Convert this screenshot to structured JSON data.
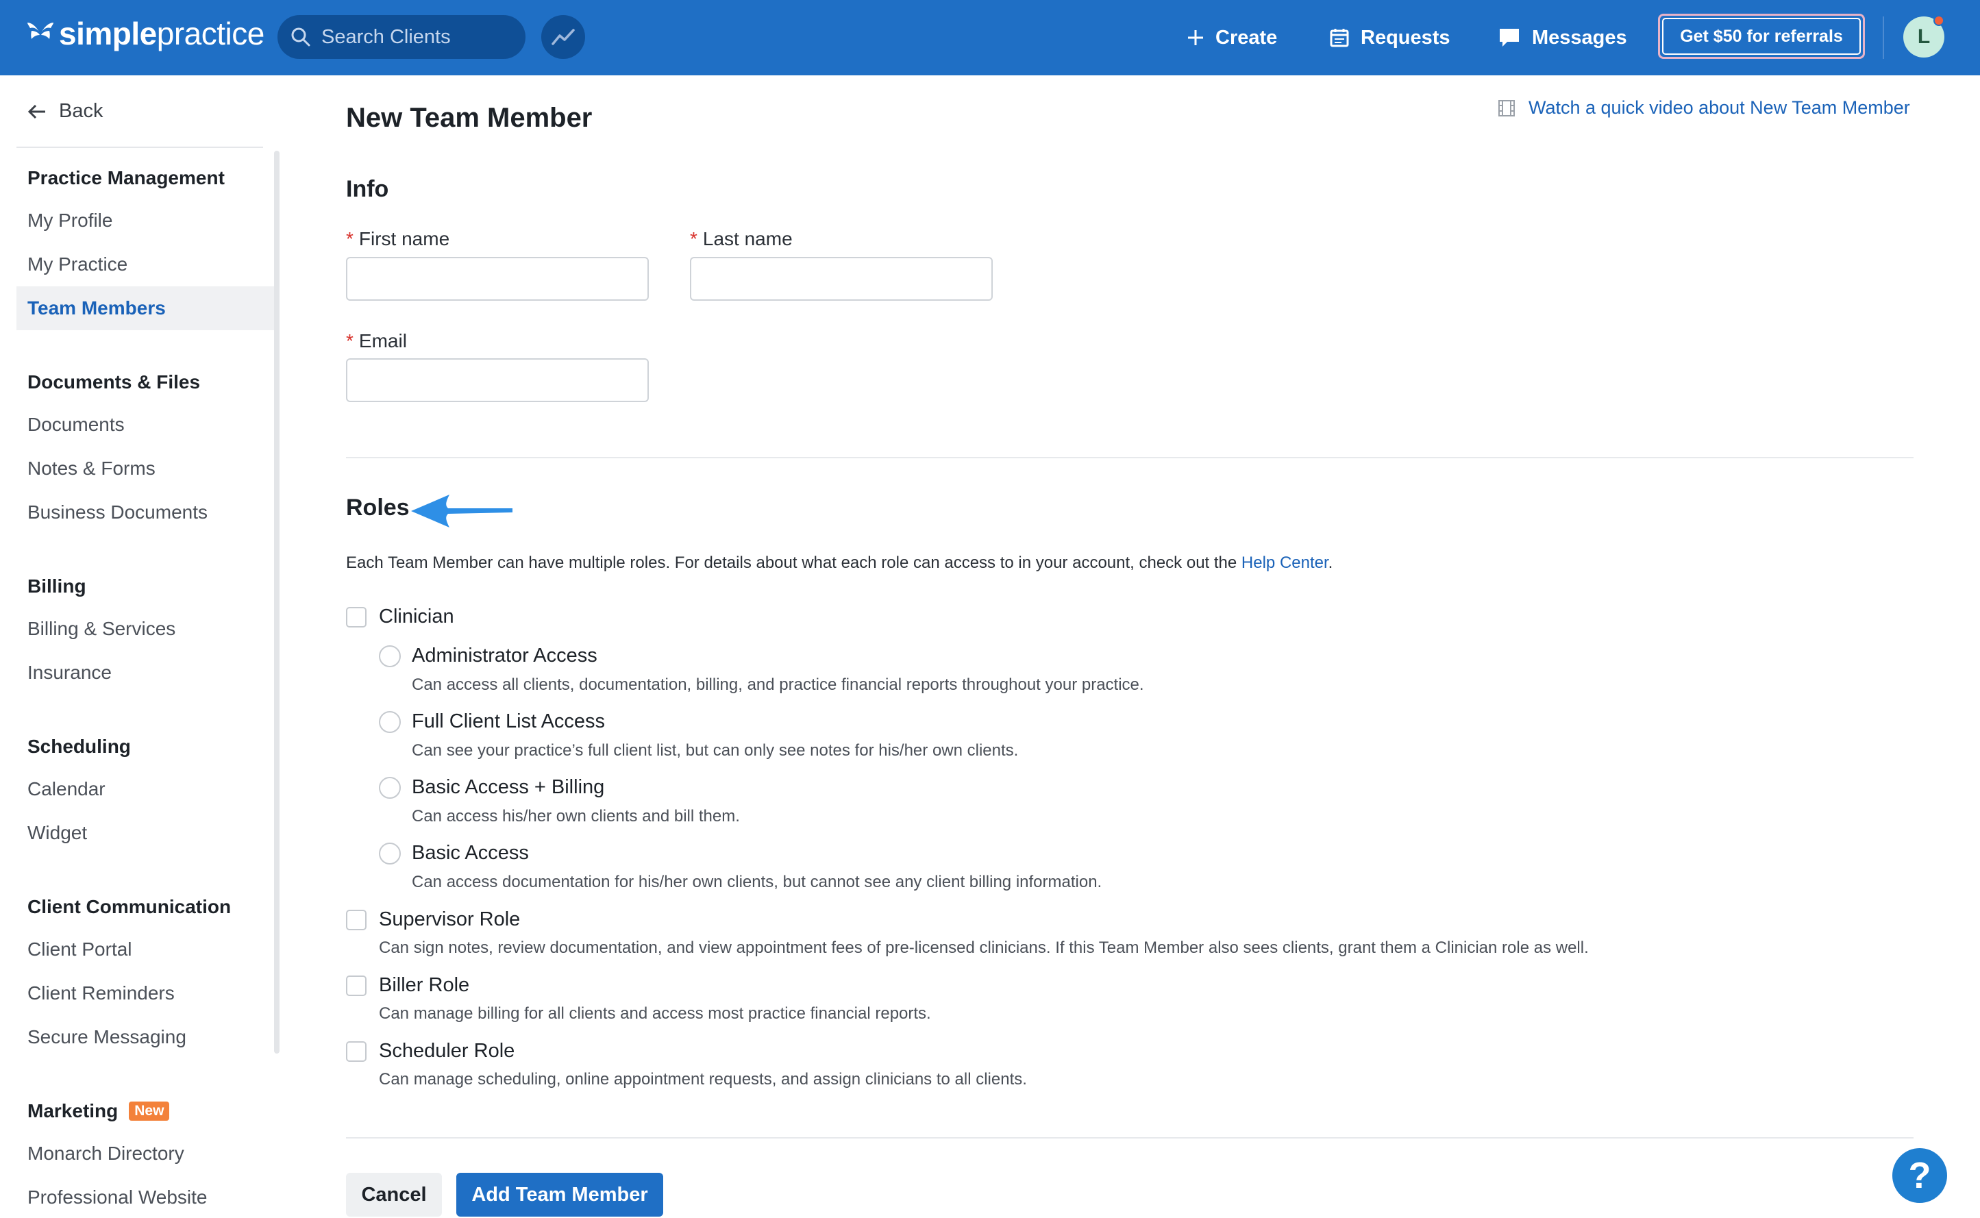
{
  "topbar": {
    "logo_bold": "simple",
    "logo_light": "practice",
    "search_placeholder": "Search Clients",
    "create_label": "Create",
    "requests_label": "Requests",
    "messages_label": "Messages",
    "referral_label": "Get $50 for referrals",
    "avatar_initial": "L"
  },
  "sidebar": {
    "back_label": "Back",
    "sections": [
      {
        "title": "Practice Management",
        "items": [
          "My Profile",
          "My Practice",
          "Team Members"
        ]
      },
      {
        "title": "Documents & Files",
        "items": [
          "Documents",
          "Notes & Forms",
          "Business Documents"
        ]
      },
      {
        "title": "Billing",
        "items": [
          "Billing & Services",
          "Insurance"
        ]
      },
      {
        "title": "Scheduling",
        "items": [
          "Calendar",
          "Widget"
        ]
      },
      {
        "title": "Client Communication",
        "items": [
          "Client Portal",
          "Client Reminders",
          "Secure Messaging"
        ]
      },
      {
        "title": "Marketing",
        "badge": "New",
        "items": [
          "Monarch Directory",
          "Professional Website"
        ]
      }
    ],
    "active_item": "Team Members"
  },
  "main": {
    "title": "New Team Member",
    "video_link": "Watch a quick video about New Team Member",
    "info": {
      "heading": "Info",
      "required_mark": "*",
      "first_name_label": "First name",
      "last_name_label": "Last name",
      "email_label": "Email",
      "first_name_value": "",
      "last_name_value": "",
      "email_value": ""
    },
    "roles": {
      "heading": "Roles",
      "intro_text": "Each Team Member can have multiple roles. For details about what each role can access to in your account, check out the ",
      "help_link": "Help Center",
      "intro_end": ".",
      "clinician_label": "Clinician",
      "clinician_options": [
        {
          "label": "Administrator Access",
          "desc": "Can access all clients, documentation, billing, and practice financial reports throughout your practice."
        },
        {
          "label": "Full Client List Access",
          "desc": "Can see your practice’s full client list, but can only see notes for his/her own clients."
        },
        {
          "label": "Basic Access + Billing",
          "desc": "Can access his/her own clients and bill them."
        },
        {
          "label": "Basic Access",
          "desc": "Can access documentation for his/her own clients, but cannot see any client billing information."
        }
      ],
      "other_roles": [
        {
          "label": "Supervisor Role",
          "desc": "Can sign notes, review documentation, and view appointment fees of pre-licensed clinicians. If this Team Member also sees clients, grant them a Clinician role as well."
        },
        {
          "label": "Biller Role",
          "desc": "Can manage billing for all clients and access most practice financial reports."
        },
        {
          "label": "Scheduler Role",
          "desc": "Can manage scheduling, online appointment requests, and assign clinicians to all clients."
        }
      ]
    },
    "actions": {
      "cancel_label": "Cancel",
      "add_label": "Add Team Member"
    },
    "help_glyph": "?"
  },
  "colors": {
    "brand_blue": "#1f6fc5",
    "link_blue": "#1a62b8",
    "required_red": "#d8332d",
    "badge_orange": "#f3813a"
  }
}
